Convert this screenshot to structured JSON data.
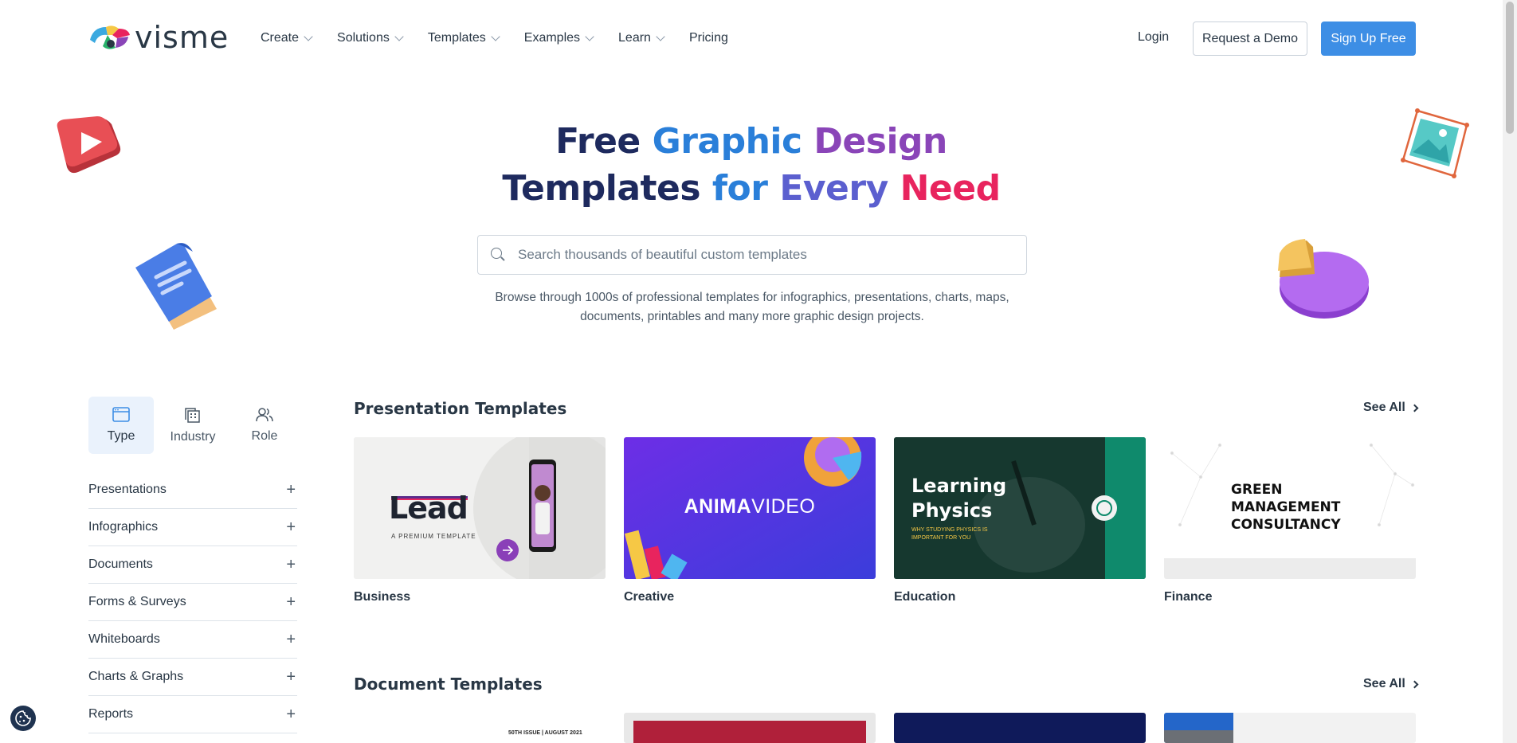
{
  "brand": {
    "name": "visme"
  },
  "nav": {
    "items": [
      {
        "label": "Create",
        "dropdown": true
      },
      {
        "label": "Solutions",
        "dropdown": true
      },
      {
        "label": "Templates",
        "dropdown": true
      },
      {
        "label": "Examples",
        "dropdown": true
      },
      {
        "label": "Learn",
        "dropdown": true
      },
      {
        "label": "Pricing",
        "dropdown": false
      }
    ],
    "login": "Login",
    "demo": "Request a Demo",
    "signup": "Sign Up Free"
  },
  "hero": {
    "title_line1": [
      "Free",
      "Graphic",
      "Design"
    ],
    "title_line2": [
      "Templates",
      "for",
      "Every",
      "Need"
    ],
    "search_placeholder": "Search thousands of beautiful custom templates",
    "subtitle": "Browse through 1000s of professional templates for infographics, presentations, charts, maps, documents, printables and many more graphic design projects."
  },
  "sidebar": {
    "tabs": [
      {
        "label": "Type",
        "icon": "browser-window-icon",
        "active": true
      },
      {
        "label": "Industry",
        "icon": "buildings-icon",
        "active": false
      },
      {
        "label": "Role",
        "icon": "users-icon",
        "active": false
      }
    ],
    "categories": [
      "Presentations",
      "Infographics",
      "Documents",
      "Forms & Surveys",
      "Whiteboards",
      "Charts & Graphs",
      "Reports"
    ]
  },
  "sections": {
    "presentation": {
      "title": "Presentation Templates",
      "see_all": "See All",
      "cards": [
        {
          "label": "Business",
          "thumb_title": "Lead",
          "thumb_sub": "A PREMIUM TEMPLATE"
        },
        {
          "label": "Creative",
          "thumb_title_bold": "ANIMA",
          "thumb_title_light": "VIDEO"
        },
        {
          "label": "Education",
          "thumb_title": "Learning Physics",
          "thumb_sub": "WHY STUDYING PHYSICS IS IMPORTANT FOR YOU"
        },
        {
          "label": "Finance",
          "thumb_title": "GREEN MANAGEMENT CONSULTANCY"
        }
      ]
    },
    "document": {
      "title": "Document Templates",
      "see_all": "See All",
      "thumb_text": "50TH ISSUE | AUGUST 2021"
    }
  },
  "colors": {
    "primary": "#3d8ee5",
    "navy": "#1e2a5e",
    "pink": "#e8245e",
    "purple": "#8a45b8"
  }
}
